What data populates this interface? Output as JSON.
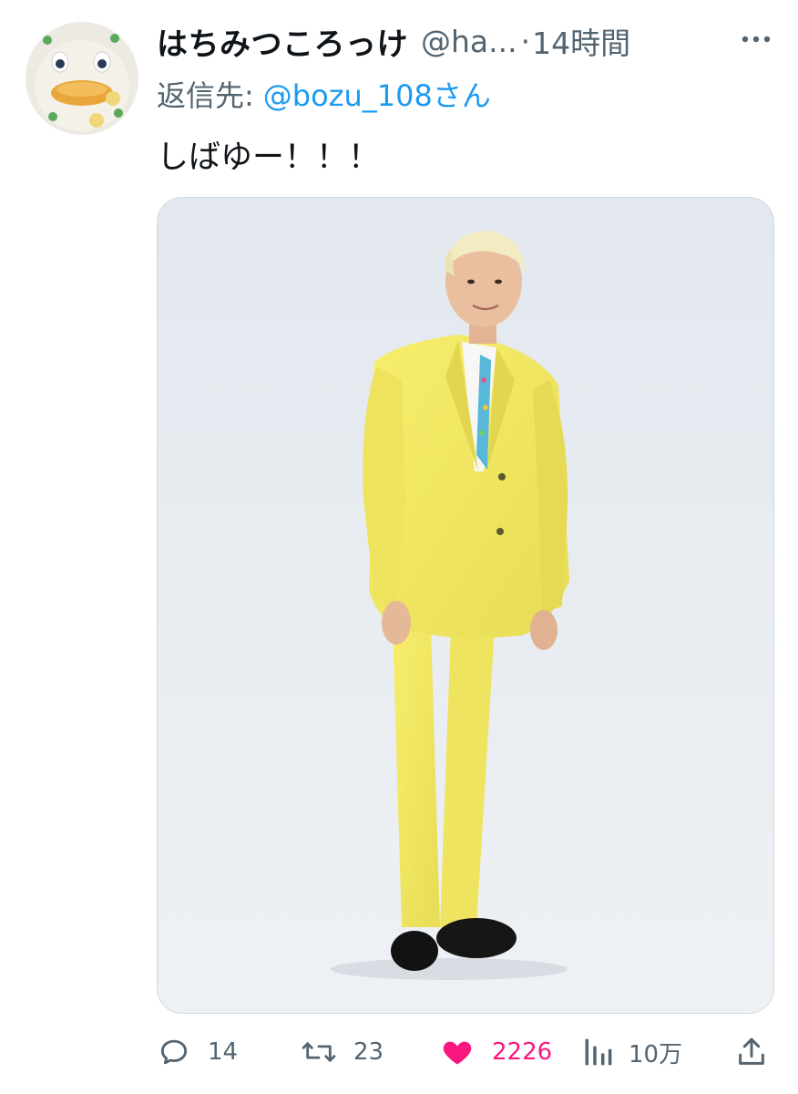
{
  "tweet": {
    "display_name": "はちみつころっけ",
    "handle": "@ha...",
    "separator": "·",
    "time": "14時間",
    "reply_prefix": "返信先:",
    "reply_to": "@bozu_108さん",
    "text": "しばゆー！！！"
  },
  "actions": {
    "replies": "14",
    "retweets": "23",
    "likes": "2226",
    "views": "10万"
  },
  "icons": {
    "more": "more-horizontal-icon",
    "reply": "reply-bubble-icon",
    "retweet": "retweet-icon",
    "like": "heart-icon-filled",
    "views": "views-bar-chart-icon",
    "share": "share-upload-icon"
  },
  "colors": {
    "text": "#0f1419",
    "secondary": "#536471",
    "link": "#1d9bf0",
    "like": "#f91880"
  }
}
